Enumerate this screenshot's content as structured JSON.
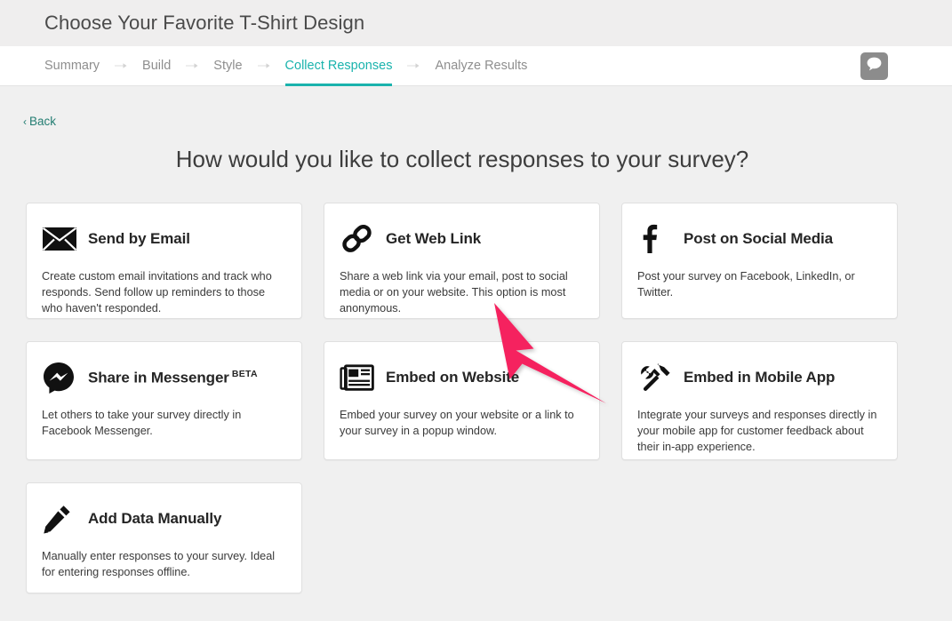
{
  "header": {
    "survey_title": "Choose Your Favorite T-Shirt Design"
  },
  "nav": {
    "steps": [
      {
        "label": "Summary",
        "active": false
      },
      {
        "label": "Build",
        "active": false
      },
      {
        "label": "Style",
        "active": false
      },
      {
        "label": "Collect Responses",
        "active": true
      },
      {
        "label": "Analyze Results",
        "active": false
      }
    ],
    "separator_icon": "arrow-right-icon",
    "chat_icon": "speech-bubble-icon",
    "accent_color": "#1ab3ad"
  },
  "back": {
    "label": "Back",
    "chevron": "‹",
    "icon": "chevron-left-icon"
  },
  "main": {
    "heading": "How would you like to collect responses to your survey?",
    "options": [
      {
        "title": "Send by Email",
        "description": "Create custom email invitations and track who responds. Send follow up reminders to those who haven't responded.",
        "icon": "envelope-icon",
        "badge": ""
      },
      {
        "title": "Get Web Link",
        "description": "Share a web link via your email, post to social media or on your website. This option is most anonymous.",
        "icon": "chain-link-icon",
        "badge": ""
      },
      {
        "title": "Post on Social Media",
        "description": "Post your survey on Facebook, LinkedIn, or Twitter.",
        "icon": "facebook-f-icon",
        "badge": ""
      },
      {
        "title": "Share in Messenger",
        "description": "Let others to take your survey directly in Facebook Messenger.",
        "icon": "messenger-icon",
        "badge": "BETA"
      },
      {
        "title": "Embed on Website",
        "description": "Embed your survey on your website or a link to your survey in a popup window.",
        "icon": "newspaper-icon",
        "badge": ""
      },
      {
        "title": "Embed in Mobile App",
        "description": "Integrate your surveys and responses directly in your mobile app for customer feedback about their in-app experience.",
        "icon": "hammer-wrench-icon",
        "badge": ""
      },
      {
        "title": "Add Data Manually",
        "description": "Manually enter responses to your survey. Ideal for entering responses offline.",
        "icon": "pencil-icon",
        "badge": ""
      }
    ]
  },
  "annotation": {
    "pointer_icon": "pink-arrow-cursor",
    "color": "#f5205f",
    "points_at": "Get Web Link"
  }
}
